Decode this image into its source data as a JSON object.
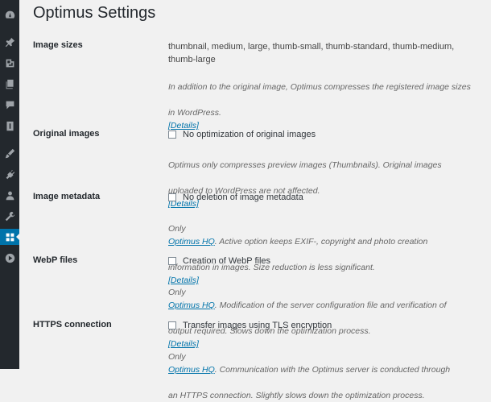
{
  "page": {
    "title": "Optimus Settings"
  },
  "sidebar": {
    "icons": [
      "dashboard-icon",
      "pin-icon",
      "media-icon",
      "pages-icon",
      "comments-icon",
      "feedback-icon",
      "appearance-icon",
      "plugins-icon",
      "users-icon",
      "tools-icon",
      "settings-icon",
      "play-icon"
    ],
    "active": "settings-icon"
  },
  "settings": {
    "image_sizes": {
      "label": "Image sizes",
      "value_line1": "thumbnail, medium, large, thumb-small, thumb-standard, thumb-medium,",
      "value_line2": "thumb-large",
      "desc_line1": "In addition to the original image, Optimus compresses the registered image sizes",
      "desc_line2": "in WordPress.",
      "link": "[Details]"
    },
    "original_images": {
      "label": "Original images",
      "checkbox": "No optimization of original images",
      "desc_line1": "Optimus only compresses preview images (Thumbnails). Original images",
      "desc_line2": "uploaded to WordPress are not affected.",
      "link": "[Details]"
    },
    "image_metadata": {
      "label": "Image metadata",
      "checkbox": "No deletion of image metadata",
      "desc_pre": "Only",
      "hq_link": "Optimus HQ",
      "desc_line1": ". Active option keeps EXIF-, copyright and photo creation",
      "desc_line2": "information in images. Size reduction is less significant.",
      "link": "[Details]"
    },
    "webp": {
      "label": "WebP files",
      "checkbox": "Creation of WebP files",
      "desc_pre": "Only",
      "hq_link": "Optimus HQ",
      "desc_line1": ". Modification of the server configuration file and verification of",
      "desc_line2": "output required. Slows down the optimization process.",
      "link": "[Details]"
    },
    "https": {
      "label": "HTTPS connection",
      "checkbox": "Transfer images using TLS encryption",
      "desc_pre": "Only",
      "hq_link": "Optimus HQ",
      "desc_line1": ". Communication with the Optimus server is conducted through",
      "desc_line2": "an HTTPS connection. Slightly slows down the optimization process."
    }
  }
}
